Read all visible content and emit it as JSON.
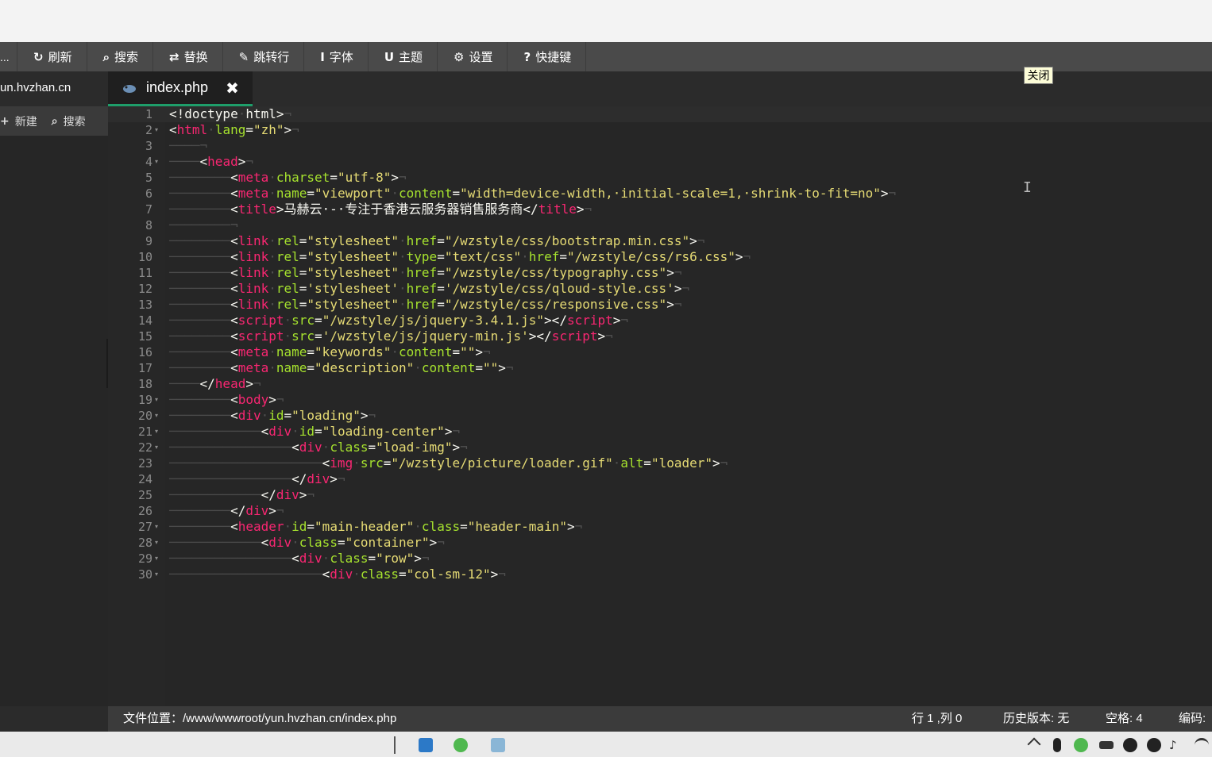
{
  "toolbar": {
    "first_label": "...",
    "items": [
      {
        "icon": "refresh-icon",
        "glyph": "↻",
        "label": "刷新"
      },
      {
        "icon": "search-icon",
        "glyph": "⌕",
        "label": "搜索"
      },
      {
        "icon": "replace-icon",
        "glyph": "⇄",
        "label": "替换"
      },
      {
        "icon": "pin-icon",
        "glyph": "✎",
        "label": "跳转行"
      },
      {
        "icon": "font-icon",
        "glyph": "I",
        "label": "字体"
      },
      {
        "icon": "magnet-icon",
        "glyph": "U",
        "label": "主题"
      },
      {
        "icon": "gear-icon",
        "glyph": "⚙",
        "label": "设置"
      },
      {
        "icon": "question-icon",
        "glyph": "?",
        "label": "快捷键"
      }
    ]
  },
  "sidebar": {
    "site_name": "un.hvzhan.cn",
    "new_label": "新建",
    "new_glyph": "+",
    "search_label": "搜索",
    "search_glyph": "⌕",
    "collapse_glyph": "‹"
  },
  "tab": {
    "file_name": "index.php",
    "close_glyph": "✖",
    "icon": "php-elephant-icon"
  },
  "tooltip": {
    "close_text": "关闭"
  },
  "editor": {
    "lines": [
      {
        "n": "1",
        "fold": false,
        "indent": 0,
        "tokens": [
          [
            "p",
            "<!doctype"
          ],
          [
            "eol",
            "·"
          ],
          [
            "p",
            "html>"
          ]
        ]
      },
      {
        "n": "2",
        "fold": true,
        "indent": 0,
        "tokens": [
          [
            "p",
            "<"
          ],
          [
            "t",
            "html"
          ],
          [
            "eol",
            "·"
          ],
          [
            "a",
            "lang"
          ],
          [
            "p",
            "="
          ],
          [
            "s",
            "\"zh\""
          ],
          [
            "p",
            ">"
          ]
        ]
      },
      {
        "n": "3",
        "fold": false,
        "indent": 1,
        "tokens": []
      },
      {
        "n": "4",
        "fold": true,
        "indent": 1,
        "tokens": [
          [
            "p",
            "<"
          ],
          [
            "t",
            "head"
          ],
          [
            "p",
            ">"
          ]
        ]
      },
      {
        "n": "5",
        "fold": false,
        "indent": 2,
        "tokens": [
          [
            "p",
            "<"
          ],
          [
            "t",
            "meta"
          ],
          [
            "eol",
            "·"
          ],
          [
            "a",
            "charset"
          ],
          [
            "p",
            "="
          ],
          [
            "s",
            "\"utf-8\""
          ],
          [
            "p",
            ">"
          ]
        ]
      },
      {
        "n": "6",
        "fold": false,
        "indent": 2,
        "tokens": [
          [
            "p",
            "<"
          ],
          [
            "t",
            "meta"
          ],
          [
            "eol",
            "·"
          ],
          [
            "a",
            "name"
          ],
          [
            "p",
            "="
          ],
          [
            "s",
            "\"viewport\""
          ],
          [
            "eol",
            "·"
          ],
          [
            "a",
            "content"
          ],
          [
            "p",
            "="
          ],
          [
            "s",
            "\"width=device-width,·initial-scale=1,·shrink-to-fit=no\""
          ],
          [
            "p",
            ">"
          ]
        ]
      },
      {
        "n": "7",
        "fold": false,
        "indent": 2,
        "tokens": [
          [
            "p",
            "<"
          ],
          [
            "t",
            "title"
          ],
          [
            "p",
            ">马赫云·-·专注于香港云服务器销售服务商</"
          ],
          [
            "t",
            "title"
          ],
          [
            "p",
            ">"
          ]
        ]
      },
      {
        "n": "8",
        "fold": false,
        "indent": 2,
        "tokens": []
      },
      {
        "n": "9",
        "fold": false,
        "indent": 2,
        "tokens": [
          [
            "p",
            "<"
          ],
          [
            "t",
            "link"
          ],
          [
            "eol",
            "·"
          ],
          [
            "a",
            "rel"
          ],
          [
            "p",
            "="
          ],
          [
            "s",
            "\"stylesheet\""
          ],
          [
            "eol",
            "·"
          ],
          [
            "a",
            "href"
          ],
          [
            "p",
            "="
          ],
          [
            "s",
            "\"/wzstyle/css/bootstrap.min.css\""
          ],
          [
            "p",
            ">"
          ]
        ]
      },
      {
        "n": "10",
        "fold": false,
        "indent": 2,
        "tokens": [
          [
            "p",
            "<"
          ],
          [
            "t",
            "link"
          ],
          [
            "eol",
            "·"
          ],
          [
            "a",
            "rel"
          ],
          [
            "p",
            "="
          ],
          [
            "s",
            "\"stylesheet\""
          ],
          [
            "eol",
            "·"
          ],
          [
            "a",
            "type"
          ],
          [
            "p",
            "="
          ],
          [
            "s",
            "\"text/css\""
          ],
          [
            "eol",
            "·"
          ],
          [
            "a",
            "href"
          ],
          [
            "p",
            "="
          ],
          [
            "s",
            "\"/wzstyle/css/rs6.css\""
          ],
          [
            "p",
            ">"
          ]
        ]
      },
      {
        "n": "11",
        "fold": false,
        "indent": 2,
        "tokens": [
          [
            "p",
            "<"
          ],
          [
            "t",
            "link"
          ],
          [
            "eol",
            "·"
          ],
          [
            "a",
            "rel"
          ],
          [
            "p",
            "="
          ],
          [
            "s",
            "\"stylesheet\""
          ],
          [
            "eol",
            "·"
          ],
          [
            "a",
            "href"
          ],
          [
            "p",
            "="
          ],
          [
            "s",
            "\"/wzstyle/css/typography.css\""
          ],
          [
            "p",
            ">"
          ]
        ]
      },
      {
        "n": "12",
        "fold": false,
        "indent": 2,
        "tokens": [
          [
            "p",
            "<"
          ],
          [
            "t",
            "link"
          ],
          [
            "eol",
            "·"
          ],
          [
            "a",
            "rel"
          ],
          [
            "p",
            "="
          ],
          [
            "s",
            "'stylesheet'"
          ],
          [
            "eol",
            "·"
          ],
          [
            "a",
            "href"
          ],
          [
            "p",
            "="
          ],
          [
            "s",
            "'/wzstyle/css/qloud-style.css'"
          ],
          [
            "p",
            ">"
          ]
        ]
      },
      {
        "n": "13",
        "fold": false,
        "indent": 2,
        "tokens": [
          [
            "p",
            "<"
          ],
          [
            "t",
            "link"
          ],
          [
            "eol",
            "·"
          ],
          [
            "a",
            "rel"
          ],
          [
            "p",
            "="
          ],
          [
            "s",
            "\"stylesheet\""
          ],
          [
            "eol",
            "·"
          ],
          [
            "a",
            "href"
          ],
          [
            "p",
            "="
          ],
          [
            "s",
            "\"/wzstyle/css/responsive.css\""
          ],
          [
            "p",
            ">"
          ]
        ]
      },
      {
        "n": "14",
        "fold": false,
        "indent": 2,
        "tokens": [
          [
            "p",
            "<"
          ],
          [
            "t",
            "script"
          ],
          [
            "eol",
            "·"
          ],
          [
            "a",
            "src"
          ],
          [
            "p",
            "="
          ],
          [
            "s",
            "\"/wzstyle/js/jquery-3.4.1.js\""
          ],
          [
            "p",
            "></"
          ],
          [
            "t",
            "script"
          ],
          [
            "p",
            ">"
          ]
        ]
      },
      {
        "n": "15",
        "fold": false,
        "indent": 2,
        "tokens": [
          [
            "p",
            "<"
          ],
          [
            "t",
            "script"
          ],
          [
            "eol",
            "·"
          ],
          [
            "a",
            "src"
          ],
          [
            "p",
            "="
          ],
          [
            "s",
            "'/wzstyle/js/jquery-min.js'"
          ],
          [
            "p",
            "></"
          ],
          [
            "t",
            "script"
          ],
          [
            "p",
            ">"
          ]
        ]
      },
      {
        "n": "16",
        "fold": false,
        "indent": 2,
        "tokens": [
          [
            "p",
            "<"
          ],
          [
            "t",
            "meta"
          ],
          [
            "eol",
            "·"
          ],
          [
            "a",
            "name"
          ],
          [
            "p",
            "="
          ],
          [
            "s",
            "\"keywords\""
          ],
          [
            "eol",
            "·"
          ],
          [
            "a",
            "content"
          ],
          [
            "p",
            "="
          ],
          [
            "s",
            "\"\""
          ],
          [
            "p",
            ">"
          ]
        ]
      },
      {
        "n": "17",
        "fold": false,
        "indent": 2,
        "tokens": [
          [
            "p",
            "<"
          ],
          [
            "t",
            "meta"
          ],
          [
            "eol",
            "·"
          ],
          [
            "a",
            "name"
          ],
          [
            "p",
            "="
          ],
          [
            "s",
            "\"description\""
          ],
          [
            "eol",
            "·"
          ],
          [
            "a",
            "content"
          ],
          [
            "p",
            "="
          ],
          [
            "s",
            "\"\""
          ],
          [
            "p",
            ">"
          ]
        ]
      },
      {
        "n": "18",
        "fold": false,
        "indent": 1,
        "tokens": [
          [
            "p",
            "</"
          ],
          [
            "t",
            "head"
          ],
          [
            "p",
            ">"
          ]
        ]
      },
      {
        "n": "19",
        "fold": true,
        "indent": 2,
        "tokens": [
          [
            "p",
            "<"
          ],
          [
            "t",
            "body"
          ],
          [
            "p",
            ">"
          ]
        ]
      },
      {
        "n": "20",
        "fold": true,
        "indent": 2,
        "tokens": [
          [
            "p",
            "<"
          ],
          [
            "t",
            "div"
          ],
          [
            "eol",
            "·"
          ],
          [
            "a",
            "id"
          ],
          [
            "p",
            "="
          ],
          [
            "s",
            "\"loading\""
          ],
          [
            "p",
            ">"
          ]
        ]
      },
      {
        "n": "21",
        "fold": true,
        "indent": 3,
        "tokens": [
          [
            "p",
            "<"
          ],
          [
            "t",
            "div"
          ],
          [
            "eol",
            "·"
          ],
          [
            "a",
            "id"
          ],
          [
            "p",
            "="
          ],
          [
            "s",
            "\"loading-center\""
          ],
          [
            "p",
            ">"
          ]
        ]
      },
      {
        "n": "22",
        "fold": true,
        "indent": 4,
        "tokens": [
          [
            "p",
            "<"
          ],
          [
            "t",
            "div"
          ],
          [
            "eol",
            "·"
          ],
          [
            "a",
            "class"
          ],
          [
            "p",
            "="
          ],
          [
            "s",
            "\"load-img\""
          ],
          [
            "p",
            ">"
          ]
        ]
      },
      {
        "n": "23",
        "fold": false,
        "indent": 5,
        "tokens": [
          [
            "p",
            "<"
          ],
          [
            "t",
            "img"
          ],
          [
            "eol",
            "·"
          ],
          [
            "a",
            "src"
          ],
          [
            "p",
            "="
          ],
          [
            "s",
            "\"/wzstyle/picture/loader.gif\""
          ],
          [
            "eol",
            "·"
          ],
          [
            "a",
            "alt"
          ],
          [
            "p",
            "="
          ],
          [
            "s",
            "\"loader\""
          ],
          [
            "p",
            ">"
          ]
        ]
      },
      {
        "n": "24",
        "fold": false,
        "indent": 4,
        "tokens": [
          [
            "p",
            "</"
          ],
          [
            "t",
            "div"
          ],
          [
            "p",
            ">"
          ]
        ]
      },
      {
        "n": "25",
        "fold": false,
        "indent": 3,
        "tokens": [
          [
            "p",
            "</"
          ],
          [
            "t",
            "div"
          ],
          [
            "p",
            ">"
          ]
        ]
      },
      {
        "n": "26",
        "fold": false,
        "indent": 2,
        "tokens": [
          [
            "p",
            "</"
          ],
          [
            "t",
            "div"
          ],
          [
            "p",
            ">"
          ]
        ]
      },
      {
        "n": "27",
        "fold": true,
        "indent": 2,
        "tokens": [
          [
            "p",
            "<"
          ],
          [
            "t",
            "header"
          ],
          [
            "eol",
            "·"
          ],
          [
            "a",
            "id"
          ],
          [
            "p",
            "="
          ],
          [
            "s",
            "\"main-header\""
          ],
          [
            "eol",
            "·"
          ],
          [
            "a",
            "class"
          ],
          [
            "p",
            "="
          ],
          [
            "s",
            "\"header-main\""
          ],
          [
            "p",
            ">"
          ]
        ]
      },
      {
        "n": "28",
        "fold": true,
        "indent": 3,
        "tokens": [
          [
            "p",
            "<"
          ],
          [
            "t",
            "div"
          ],
          [
            "eol",
            "·"
          ],
          [
            "a",
            "class"
          ],
          [
            "p",
            "="
          ],
          [
            "s",
            "\"container\""
          ],
          [
            "p",
            ">"
          ]
        ]
      },
      {
        "n": "29",
        "fold": true,
        "indent": 4,
        "tokens": [
          [
            "p",
            "<"
          ],
          [
            "t",
            "div"
          ],
          [
            "eol",
            "·"
          ],
          [
            "a",
            "class"
          ],
          [
            "p",
            "="
          ],
          [
            "s",
            "\"row\""
          ],
          [
            "p",
            ">"
          ]
        ]
      },
      {
        "n": "30",
        "fold": true,
        "indent": 5,
        "tokens": [
          [
            "p",
            "<"
          ],
          [
            "t",
            "div"
          ],
          [
            "eol",
            "·"
          ],
          [
            "a",
            "class"
          ],
          [
            "p",
            "="
          ],
          [
            "s",
            "\"col-sm-12\""
          ],
          [
            "p",
            ">"
          ]
        ]
      }
    ],
    "eol_glyph": "¬",
    "fold_glyph": "▾"
  },
  "statusbar": {
    "path_label": "文件位置：",
    "path": "/www/wwwroot/yun.hvzhan.cn/index.php",
    "position": "行 1 ,列 0",
    "history": "历史版本: 无",
    "spaces": "空格: 4",
    "encoding": "编码:"
  },
  "colors": {
    "tag": "#f92672",
    "attr": "#a6e22e",
    "string": "#e6db74",
    "accent": "#1e9e6a"
  }
}
